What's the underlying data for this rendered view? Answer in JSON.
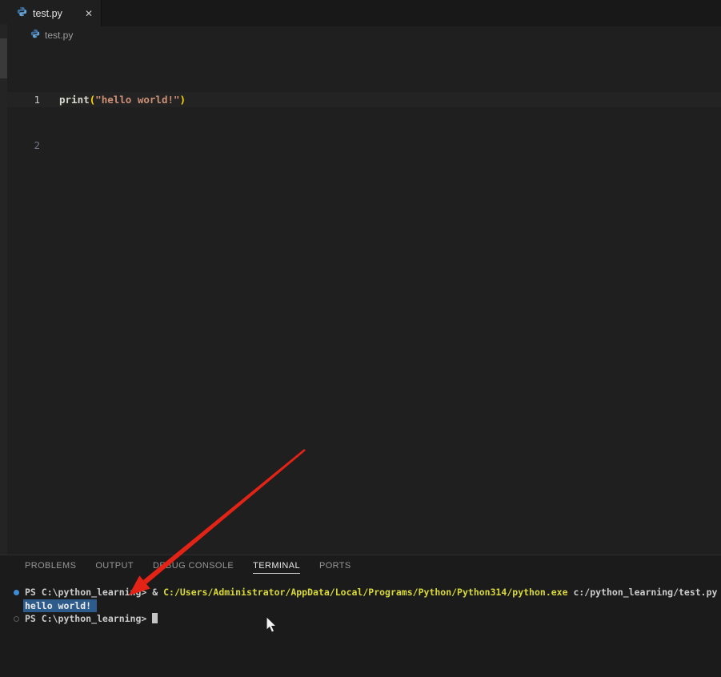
{
  "tab_bar": {
    "tabs": [
      {
        "label": "test.py",
        "close_glyph": "✕",
        "active": true,
        "icon": "python-file-icon"
      }
    ]
  },
  "breadcrumb": {
    "file": "test.py",
    "icon": "python-file-icon"
  },
  "editor": {
    "lines": [
      {
        "number": "1",
        "tokens": [
          {
            "text": "print",
            "style": "function"
          },
          {
            "text": "(",
            "style": "bracket"
          },
          {
            "text": "\"hello world!\"",
            "style": "string"
          },
          {
            "text": ")",
            "style": "bracket"
          }
        ]
      },
      {
        "number": "2",
        "tokens": []
      }
    ]
  },
  "panel": {
    "tabs": [
      {
        "label": "PROBLEMS",
        "active": false
      },
      {
        "label": "OUTPUT",
        "active": false
      },
      {
        "label": "DEBUG CONSOLE",
        "active": false
      },
      {
        "label": "TERMINAL",
        "active": true
      },
      {
        "label": "PORTS",
        "active": false
      }
    ]
  },
  "terminal": {
    "lines": [
      {
        "decoration": "filled",
        "segments": [
          {
            "text": "PS C:\\python_learning> & ",
            "style": "fg"
          },
          {
            "text": "C:/Users/Administrator/AppData/Local/Programs/Python/Python314/python.exe",
            "style": "command"
          },
          {
            "text": " c:/python_learning/test.py",
            "style": "fg"
          }
        ],
        "cursor": false
      },
      {
        "decoration": null,
        "segments": [
          {
            "text": "hello world! ",
            "style": "selected"
          }
        ],
        "cursor": false
      },
      {
        "decoration": "outline",
        "segments": [
          {
            "text": "PS C:\\python_learning> ",
            "style": "fg"
          }
        ],
        "cursor": true
      }
    ]
  },
  "colors": {
    "bg_tabbar": "#181818",
    "bg_tab": "#1f1f1f",
    "bg_editor": "#1f1f1f",
    "bg_panel": "#1b1b1b",
    "border_panel": "#2e2e2e",
    "fg_tab": "#e4e4e4",
    "fg_close": "#c5c5c5",
    "fg_breadcrumb": "#9d9d9d",
    "lineno": "#6e7681",
    "lineno_active": "#c6c6c6",
    "line_highlight": "#232323",
    "code_function": "#d8d8ce",
    "code_bracket": "#ffd700",
    "code_string": "#ce9178",
    "ptab": "#969696",
    "ptab_active": "#e7e7e7",
    "term_fg": "#cccccc",
    "term_command": "#d8d838",
    "term_selection": "#2d5c8c",
    "dot_blue": "#3f8cd6",
    "ring_gray": "#5a5a5a",
    "cursor": "#c4c4c4",
    "arrow_red": "#e32316",
    "strip": "#242424",
    "strip_thumb": "#3a3a3a",
    "python_icon_dark": "#3e6d9c",
    "python_icon_light": "#64a3d8"
  }
}
